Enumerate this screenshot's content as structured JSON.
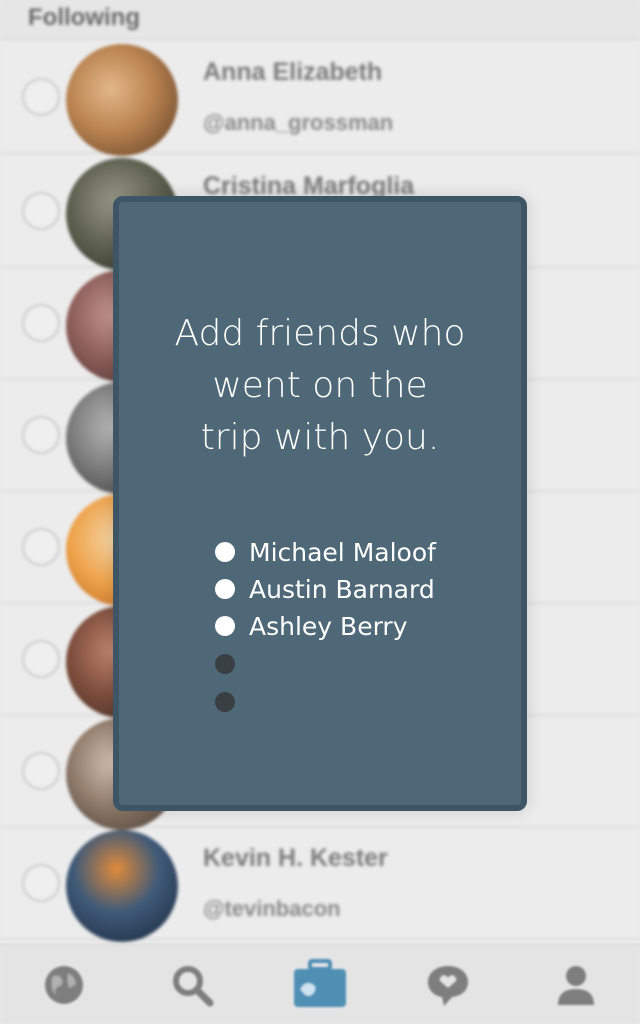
{
  "list": {
    "section_title": "Following",
    "rows": [
      {
        "name": "Anna Elizabeth",
        "handle": "@anna_grossman"
      },
      {
        "name": "Cristina Marfoglia",
        "handle": ""
      },
      {
        "name": "",
        "handle": ""
      },
      {
        "name": "",
        "handle": ""
      },
      {
        "name": "",
        "handle": ""
      },
      {
        "name": "",
        "handle": ""
      },
      {
        "name": "",
        "handle": ""
      },
      {
        "name": "Kevin H. Kester",
        "handle": "@tevinbacon"
      }
    ]
  },
  "modal": {
    "title_lines": [
      "Add friends who",
      "went on the",
      "trip with you."
    ],
    "friends": [
      "Michael Maloof",
      "Austin Barnard",
      "Ashley Berry",
      "",
      ""
    ]
  },
  "tabbar": {
    "tabs": [
      "globe-icon",
      "search-icon",
      "suitcase-icon",
      "chat-bubble-icon",
      "profile-icon"
    ],
    "active_index": 2
  },
  "colors": {
    "modal_bg": "#4e6878",
    "modal_border": "#3d5564",
    "active_tab": "#4f8fb4",
    "inactive_tab": "#7e7e7e"
  }
}
